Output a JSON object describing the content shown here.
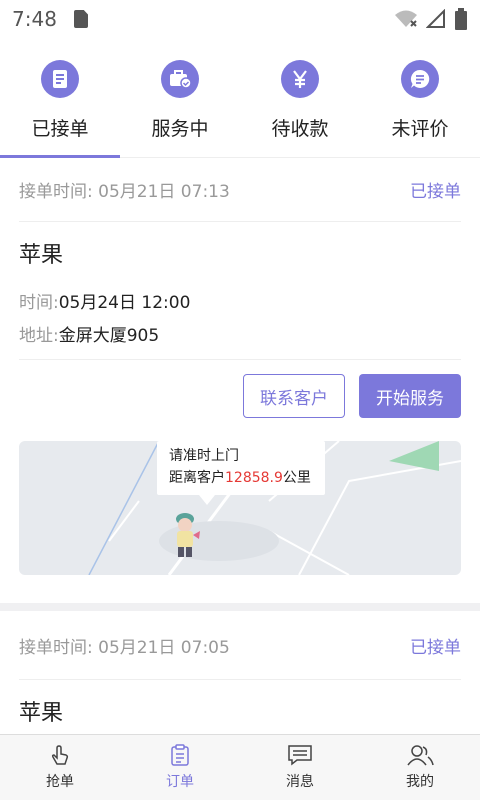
{
  "status_bar": {
    "time": "7:48"
  },
  "tabs": [
    {
      "label": "已接单",
      "icon": "document-icon"
    },
    {
      "label": "服务中",
      "icon": "briefcase-check-icon"
    },
    {
      "label": "待收款",
      "icon": "yen-icon"
    },
    {
      "label": "未评价",
      "icon": "chat-bubble-icon"
    }
  ],
  "active_tab": "已接单",
  "orders": [
    {
      "accept_time_label": "接单时间:",
      "accept_time": "05月21日 07:13",
      "status": "已接单",
      "product": "苹果",
      "time_label": "时间:",
      "time_value": "05月24日 12:00",
      "address_label": "地址:",
      "address_value": "金屏大厦905",
      "contact_button": "联系客户",
      "start_button": "开始服务",
      "map": {
        "line1": "请准时上门",
        "distance_prefix": "距离客户",
        "distance_value": "12858.9",
        "distance_unit": "公里"
      }
    },
    {
      "accept_time_label": "接单时间:",
      "accept_time": "05月21日 07:05",
      "status": "已接单",
      "product": "苹果"
    }
  ],
  "bottom_nav": [
    {
      "label": "抢单",
      "icon": "hand-tap-icon"
    },
    {
      "label": "订单",
      "icon": "clipboard-icon"
    },
    {
      "label": "消息",
      "icon": "message-icon"
    },
    {
      "label": "我的",
      "icon": "user-icon"
    }
  ],
  "colors": {
    "accent": "#7C78DB",
    "distance_red": "#E53935"
  }
}
